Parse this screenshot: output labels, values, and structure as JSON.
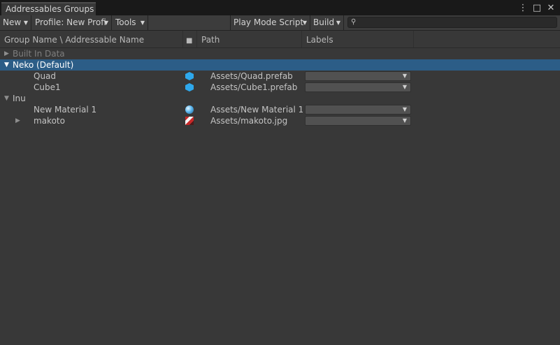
{
  "window": {
    "tab_title": "Addressables Groups"
  },
  "window_controls": [
    "more-icon",
    "maximize-icon",
    "close-icon"
  ],
  "toolbar": {
    "new_label": "New",
    "profile_label": "Profile: New Profi",
    "tools_label": "Tools",
    "play_mode_label": "Play Mode Script",
    "build_label": "Build",
    "search_value": ""
  },
  "columns": {
    "group_name": "Group Name \\ Addressable Name",
    "path": "Path",
    "labels": "Labels"
  },
  "groups": {
    "built_in": "Built In Data",
    "neko": "Neko (Default)",
    "inu": "Inu"
  },
  "entries": [
    {
      "name": "Quad",
      "path": "Assets/Quad.prefab",
      "icon": "prefab-icon",
      "label": ""
    },
    {
      "name": "Cube1",
      "path": "Assets/Cube1.prefab",
      "icon": "prefab-icon",
      "label": ""
    },
    {
      "name": "New Material 1",
      "path": "Assets/New Material 1.",
      "icon": "material-icon",
      "label": ""
    },
    {
      "name": "makoto",
      "path": "Assets/makoto.jpg",
      "icon": "texture-icon",
      "label": ""
    }
  ],
  "colors": {
    "selection": "#2c5d87",
    "panel": "#383838",
    "prefab": "#2ea8ec"
  }
}
